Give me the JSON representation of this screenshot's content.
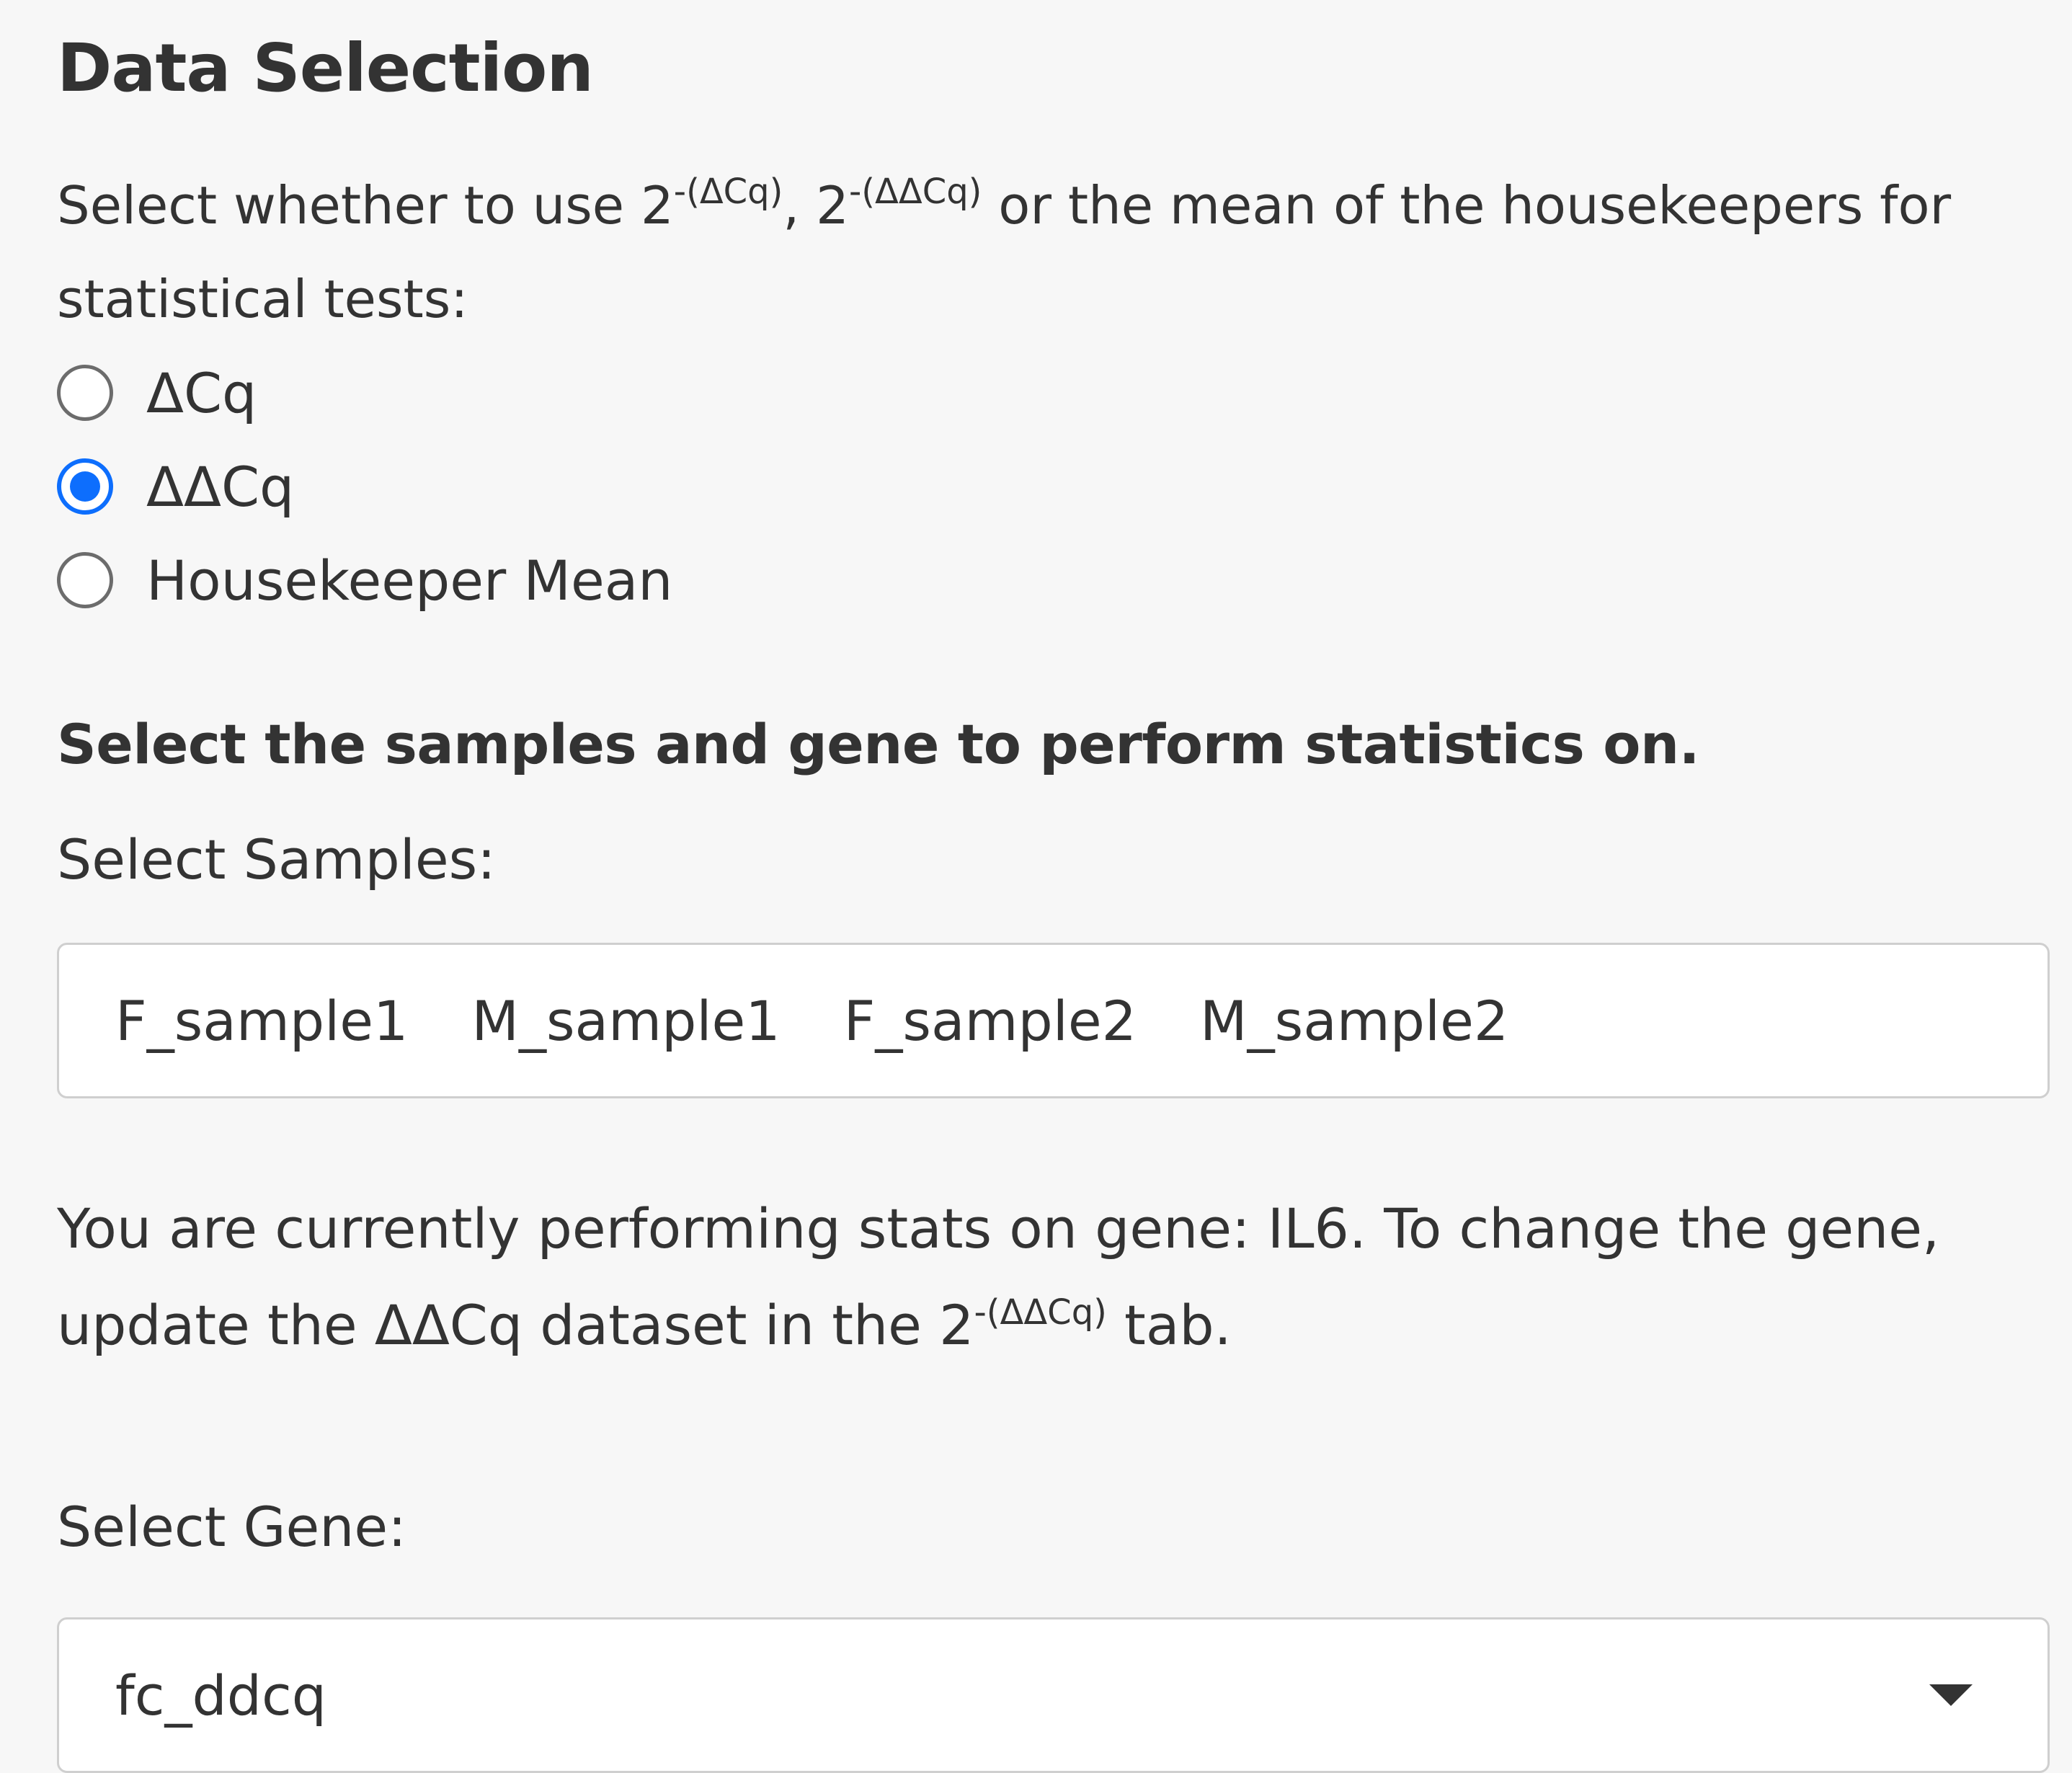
{
  "section": {
    "title": "Data Selection"
  },
  "instructions": {
    "text_1": "Select whether to use 2",
    "sup_1": "-(ΔCq)",
    "text_2": ", 2",
    "sup_2": "-(ΔΔCq)",
    "text_3": " or the mean of the housekeepers for statistical tests:"
  },
  "radio_options": [
    {
      "label": "ΔCq",
      "selected": false
    },
    {
      "label": "ΔΔCq",
      "selected": true
    },
    {
      "label": "Housekeeper Mean",
      "selected": false
    }
  ],
  "subheading": "Select the samples and gene to perform statistics on.",
  "samples": {
    "label": "Select Samples:",
    "selected": [
      "F_sample1",
      "M_sample1",
      "F_sample2",
      "M_sample2"
    ]
  },
  "gene_info": {
    "text_1": "You are currently performing stats on gene: IL6. To change the gene, update the ΔΔCq dataset in the 2",
    "sup": "-(ΔΔCq)",
    "text_2": " tab."
  },
  "gene": {
    "label": "Select Gene:",
    "selected_value": "fc_ddcq"
  },
  "icons": {
    "select_caret": "chevron-down-icon"
  },
  "colors": {
    "accent": "#0d6efd",
    "background": "#f7f7f7",
    "text": "#333333",
    "input_border": "#cfcfcf"
  }
}
